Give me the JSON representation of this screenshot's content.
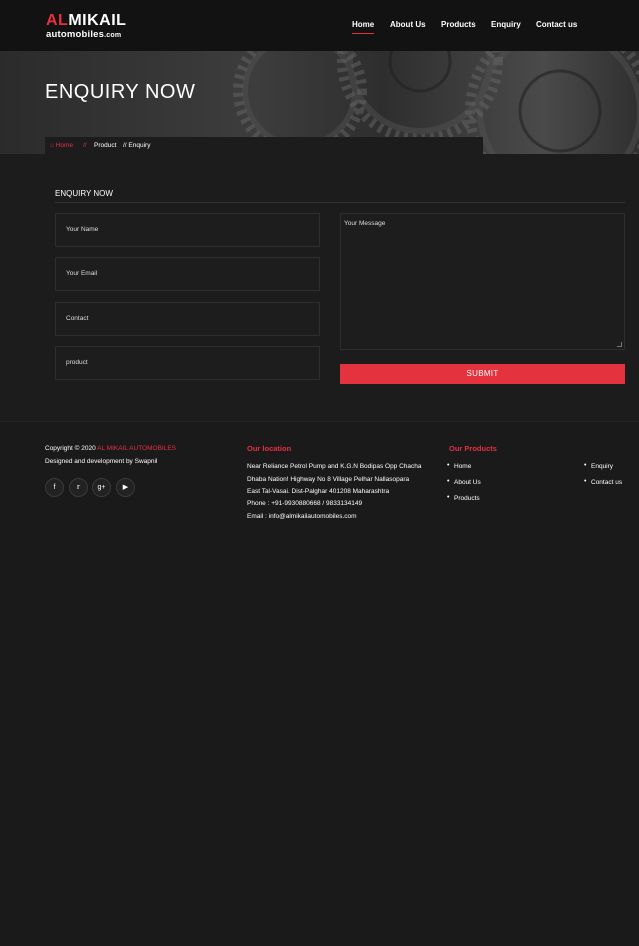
{
  "header": {
    "logo_part1": "AL",
    "logo_part2": "MIKAIL",
    "logo_sub": "automobiles",
    "logo_sub_ext": ".com",
    "nav": [
      "Home",
      "About Us",
      "Products",
      "Enquiry",
      "Contact us"
    ]
  },
  "hero": {
    "title": "ENQUIRY NOW",
    "breadcrumb": {
      "home": "Home",
      "separator": "//",
      "product": "Product",
      "current": "// Enquiry"
    }
  },
  "form": {
    "section_title": "ENQUIRY NOW",
    "name_placeholder": "Your Name",
    "email_placeholder": "Your Email",
    "contact_placeholder": "Contact",
    "product_placeholder": "product",
    "message_placeholder": "Your Message",
    "submit_label": "SUBMIT"
  },
  "footer": {
    "copyright": "Copyright © 2020",
    "company": "AL MIKAIL AUTOMOBILES",
    "designed": "Designed and development by Swapnil",
    "social_icons": [
      "facebook-icon",
      "twitter-icon",
      "google-plus-icon",
      "youtube-icon"
    ],
    "location_heading": "Our location",
    "address_lines": [
      "Near Reliance Petrol Pump and K.G.N Bodipas Opp Chacha",
      "Dhaba Nation! Highway No 8 Village Pelhar Nallasopara",
      "East Tal-Vasai. Dist-Palghar 401208 Maharashtra"
    ],
    "phone": "Phone : +91-9930880668 / 9833134149",
    "email": "Email : info@almikailautomobiles.com",
    "products_heading": "Our Products",
    "links_col1": [
      "Home",
      "About Us",
      "Products"
    ],
    "links_col2": [
      "Enquiry",
      "Contact us"
    ]
  },
  "colors": {
    "accent": "#e63040",
    "background": "#1c1c1d"
  }
}
